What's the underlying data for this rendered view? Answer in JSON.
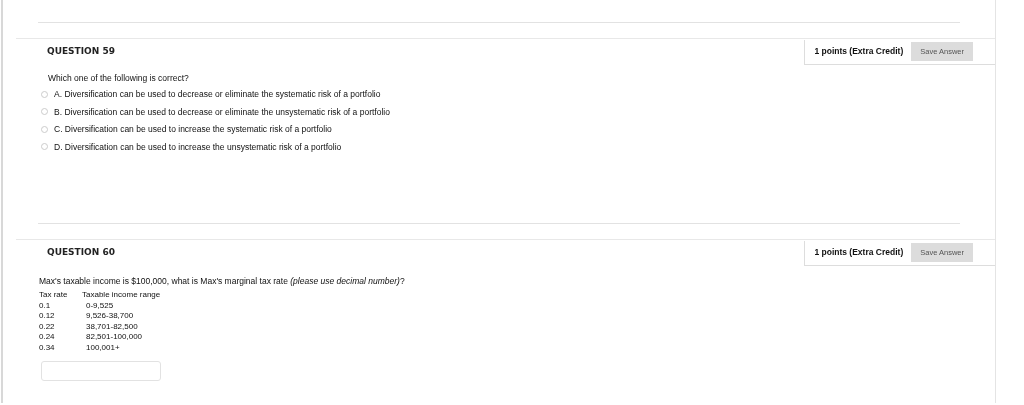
{
  "questions": [
    {
      "kind": "choice",
      "title": "QUESTION 59",
      "points": "1 points (Extra Credit)",
      "save_button": "Save Answer",
      "prompt": "Which one of the following is correct?",
      "options": [
        {
          "label": "A. Diversification can be used to decrease or eliminate the systematic risk of a portfolio",
          "selected": false
        },
        {
          "label": "B. Diversification can be used to decrease or eliminate the unsystematic risk of a portfolio",
          "selected": false
        },
        {
          "label": "C. Diversification can be used to increase the systematic risk of a portfolio",
          "selected": false
        },
        {
          "label": "D. Diversification can be used to increase the unsystematic risk of a portfolio",
          "selected": false
        }
      ]
    },
    {
      "kind": "fill",
      "title": "QUESTION 60",
      "points": "1 points (Extra Credit)",
      "save_button": "Save Answer",
      "prompt": "Max's taxable income is $100,000, what is Max's marginal tax rate *(please use decimal number)*?",
      "table": {
        "columns": [
          "Tax rate",
          "Taxable income range"
        ],
        "rows": [
          [
            "0.1",
            "0-9,525"
          ],
          [
            "0.12",
            "9,526-38,700"
          ],
          [
            "0.22",
            "38,701-82,500"
          ],
          [
            "0.24",
            "82,501-100,000"
          ],
          [
            "0.34",
            "100,001+"
          ]
        ]
      }
    }
  ]
}
